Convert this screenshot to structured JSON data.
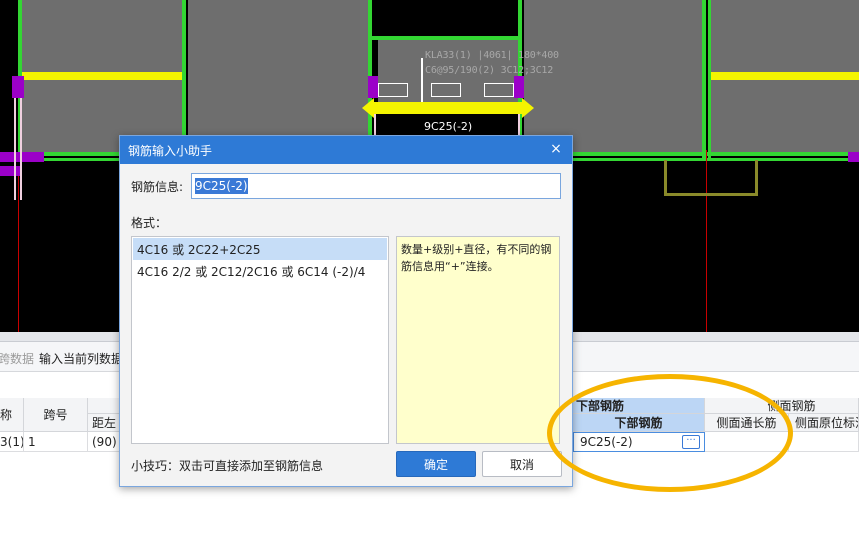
{
  "cad": {
    "beam_label_line1": "KLA33(1) |4061| 180*400",
    "beam_label_line2": "C6@95/190(2) 3C12;3C12",
    "bottom_rebar_label": "9C25(-2)",
    "colors": {
      "background": "#000000",
      "slab": "#6e6e6e",
      "beam_edge": "#33d633",
      "highlight": "#f4f400",
      "column": "#9b00c8",
      "axis": "#c80000"
    }
  },
  "toolbar_strip": {
    "left_partial": "跨数据",
    "input_current_column": "输入当前列数据"
  },
  "table": {
    "headers_left": [
      "称",
      "跨号",
      "距左"
    ],
    "row": {
      "name_partial": "3(1)",
      "span_no": "1",
      "dist_left": "(90)"
    },
    "bottom_group": "下部钢筋",
    "bottom_sub": "下部钢筋",
    "bottom_value": "9C25(-2)",
    "side_group": "侧面钢筋",
    "side_long": "侧面通长筋",
    "side_orig": "侧面原位标注"
  },
  "dialog": {
    "title": "钢筋输入小助手",
    "close_glyph": "×",
    "info_label": "钢筋信息:",
    "info_value": "9C25(-2)",
    "format_label": "格式：",
    "formats": [
      {
        "text": "4C16 或 2C22+2C25",
        "selected": true
      },
      {
        "text": "4C16 2/2 或 2C12/2C16 或 6C14 (-2)/4",
        "selected": false
      }
    ],
    "hint": "数量+级别+直径，有不同的钢筋信息用“+”连接。",
    "tip": "小技巧：双击可直接添加至钢筋信息",
    "ok_label": "确定",
    "cancel_label": "取消"
  },
  "annotation": {
    "ellipse_color": "#f6b400"
  }
}
